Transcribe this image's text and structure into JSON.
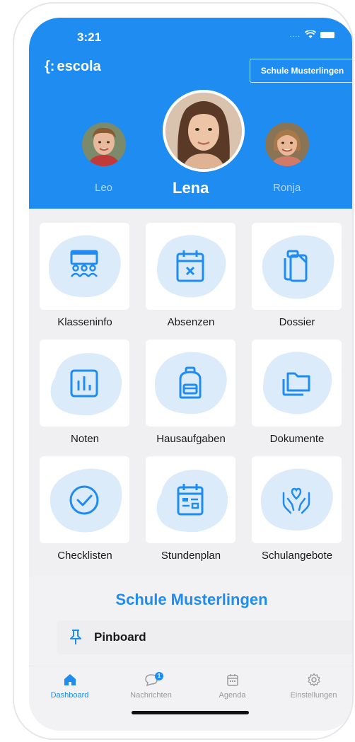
{
  "status_bar": {
    "time": "3:21",
    "signal": "...."
  },
  "header": {
    "logo_text": "escola",
    "logo_mark": "{:",
    "school_button": "Schule Musterlingen",
    "profiles": [
      {
        "name": "Leo",
        "selected": false
      },
      {
        "name": "Lena",
        "selected": true
      },
      {
        "name": "Ronja",
        "selected": false
      }
    ]
  },
  "tiles": [
    {
      "label": "Klasseninfo",
      "icon": "class-info-icon"
    },
    {
      "label": "Absenzen",
      "icon": "calendar-x-icon"
    },
    {
      "label": "Dossier",
      "icon": "clipboard-copy-icon"
    },
    {
      "label": "Noten",
      "icon": "bar-chart-icon"
    },
    {
      "label": "Hausaufgaben",
      "icon": "backpack-icon"
    },
    {
      "label": "Dokumente",
      "icon": "folders-icon"
    },
    {
      "label": "Checklisten",
      "icon": "check-circle-icon"
    },
    {
      "label": "Stundenplan",
      "icon": "timetable-icon"
    },
    {
      "label": "Schulangebote",
      "icon": "hands-heart-icon"
    }
  ],
  "school_section": {
    "title": "Schule Musterlingen",
    "pinboard_label": "Pinboard"
  },
  "tabbar": {
    "tabs": [
      {
        "label": "Dashboard",
        "icon": "home-icon",
        "active": true
      },
      {
        "label": "Nachrichten",
        "icon": "chat-icon",
        "badge": "1"
      },
      {
        "label": "Agenda",
        "icon": "calendar-icon"
      },
      {
        "label": "Einstellungen",
        "icon": "gear-icon"
      }
    ]
  },
  "colors": {
    "accent": "#1e8cf0",
    "blob": "#dcebfa",
    "background": "#f0f0f2"
  }
}
